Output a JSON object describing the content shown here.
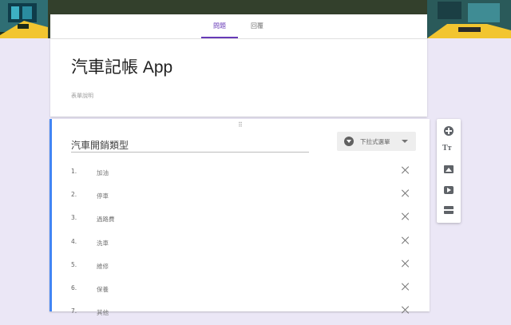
{
  "tabs": {
    "questions": "問題",
    "responses": "回覆"
  },
  "form": {
    "title": "汽車記帳 App",
    "description": "表單說明"
  },
  "question": {
    "title": "汽車開銷類型",
    "type_label": "下拉式選單",
    "options": [
      {
        "num": "1",
        "label": "加油"
      },
      {
        "num": "2",
        "label": "停車"
      },
      {
        "num": "3",
        "label": "過路費"
      },
      {
        "num": "4",
        "label": "洗車"
      },
      {
        "num": "5",
        "label": "維修"
      },
      {
        "num": "6",
        "label": "保養"
      },
      {
        "num": "7",
        "label": "其他"
      }
    ]
  },
  "toolbar": {
    "text_icon": "Tт"
  },
  "colors": {
    "accent": "#673ab7",
    "question_border": "#4285f4",
    "background": "#ebe7f6"
  }
}
